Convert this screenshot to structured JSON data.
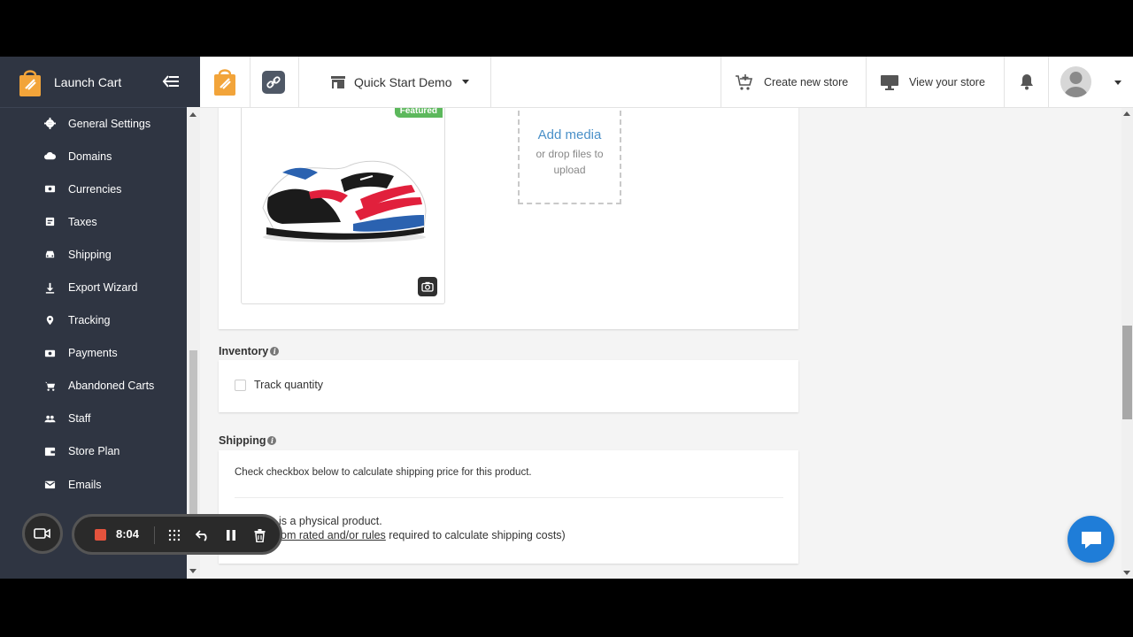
{
  "app": {
    "name": "Launch Cart",
    "store_name": "Quick Start Demo"
  },
  "header": {
    "create_store": "Create new store",
    "view_store": "View your store"
  },
  "sidebar": {
    "items": [
      {
        "label": "General Settings",
        "icon": "gear-icon"
      },
      {
        "label": "Domains",
        "icon": "cloud-icon"
      },
      {
        "label": "Currencies",
        "icon": "money-icon"
      },
      {
        "label": "Taxes",
        "icon": "receipt-icon"
      },
      {
        "label": "Shipping",
        "icon": "car-icon"
      },
      {
        "label": "Export Wizard",
        "icon": "download-icon"
      },
      {
        "label": "Tracking",
        "icon": "location-icon"
      },
      {
        "label": "Payments",
        "icon": "money-icon"
      },
      {
        "label": "Abandoned Carts",
        "icon": "cart-icon"
      },
      {
        "label": "Staff",
        "icon": "people-icon"
      },
      {
        "label": "Store Plan",
        "icon": "wallet-icon"
      },
      {
        "label": "Emails",
        "icon": "mail-icon"
      }
    ]
  },
  "media": {
    "badge": "Featured",
    "add_media": "Add media",
    "drop_hint_1": "or drop files to",
    "drop_hint_2": "upload"
  },
  "inventory": {
    "title": "Inventory",
    "track_quantity": "Track quantity",
    "track_checked": false
  },
  "shipping": {
    "title": "Shipping",
    "instruction": "Check checkbox below to calculate shipping price for this product.",
    "physical_partial": "is a physical product.",
    "rates_prefix": "om rated and/or rules",
    "rates_suffix": " required to calculate shipping costs)"
  },
  "recorder": {
    "time": "8:04"
  },
  "colors": {
    "sidebar_bg": "#2f3542",
    "accent_blue": "#4a90c8",
    "featured_green": "#5cb85c",
    "chat_blue": "#1f7dd8",
    "brand_orange": "#f2a43a"
  }
}
